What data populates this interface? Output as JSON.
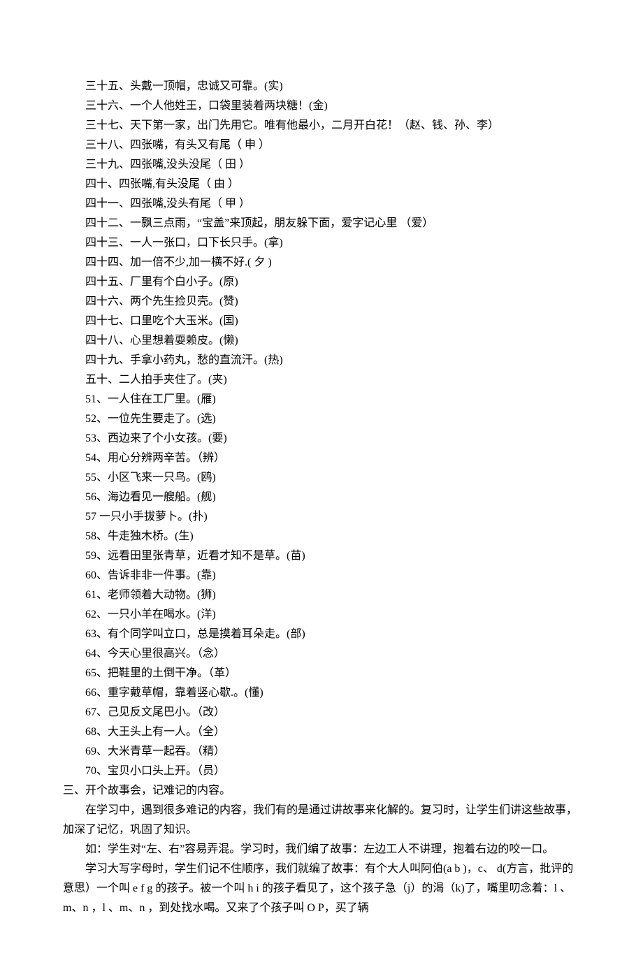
{
  "riddles": [
    "三十五、头戴一顶帽，忠诚又可靠。(实)",
    "三十六、一个人他姓王，口袋里装着两块糖！(金)",
    "三十七、天下第一家，出门先用它。唯有他最小，二月开白花！（赵、钱、孙、李）",
    "三十八、四张嘴，有头又有尾（ 申 ）",
    "三十九、四张嘴,没头没尾（ 田 ）",
    "四十、四张嘴,有头没尾（ 由 ）",
    "四十一、四张嘴,没头有尾（ 甲 ）",
    "四十二、一飘三点雨，“宝盖”来顶起，朋友躲下面，爱字记心里 （爱）",
    "四十三、一人一张口，口下长只手。(拿)",
    "四十四、加一倍不少,加一横不好.( 夕 )",
    "四十五、厂里有个白小子。(原)",
    "四十六、两个先生捡贝壳。(赞)",
    "四十七、口里吃个大玉米。(国)",
    "四十八、心里想着耍赖皮。(懒)",
    "四十九、手拿小药丸，愁的直流汗。(热)",
    "五十、二人拍手夹住了。(夹)",
    "51、一人住在工厂里。(雁)",
    "52、一位先生要走了。(选)",
    "53、西边来了个小女孩。(要)",
    "54、用心分辨两辛苦。（辨）",
    "55、小区飞来一只鸟。(鸥)",
    "56、海边看见一艘船。(舰)",
    "57 一只小手拔萝卜。(扑)",
    "58、牛走独木桥。(生)",
    "59、远看田里张青草，近看才知不是草。(苗)",
    "60、告诉非非一件事。(靠)",
    "61、老师领着大动物。(狮)",
    "62、一只小羊在喝水。(洋)",
    "63、有个同学叫立口，总是摸着耳朵走。(部)",
    "64、今天心里很高兴。（念）",
    "65、把鞋里的土倒干净。（革）",
    "66、重字戴草帽，靠着竖心歇.。(懂)",
    "67、己见反文尾巴小。（改）",
    "68、大王头上有一人。（全）",
    "69、大米青草一起吞。（精）",
    "70、宝贝小口头上开。（员）"
  ],
  "section_title": "三、开个故事会，记难记的内容。",
  "paragraphs": [
    "在学习中，遇到很多难记的内容，我们有的是通过讲故事来化解的。复习时，让学生们讲这些故事，加深了记忆，巩固了知识。",
    "如：学生对“左、右”容易弄混。学习时，我们编了故事：左边工人不讲理，抱着右边的咬一口。",
    "学习大写字母时，学生们记不住顺序，我们就编了故事：有个大人叫阿伯(a b )，c、 d(方言，批评的意思）一个叫 e f g 的孩子。被一个叫 h i 的孩子看见了，这个孩子急（j）的渴（k)了，嘴里叨念着：l 、m、n ，l 、m、n ，到处找水喝。又来了个孩子叫 O P，买了辆"
  ]
}
